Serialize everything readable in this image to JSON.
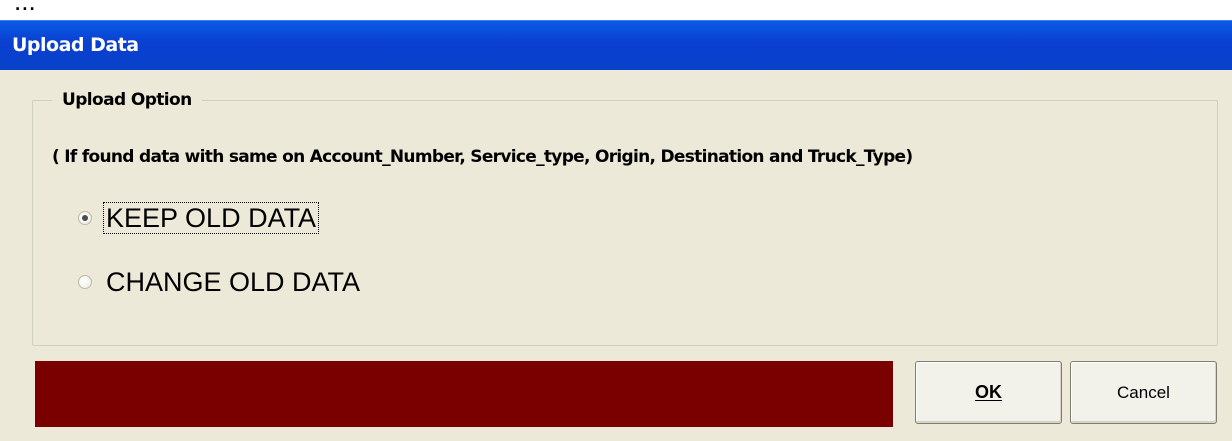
{
  "window": {
    "title": "Upload Data"
  },
  "top_strip_text": "...",
  "group": {
    "legend": "Upload Option",
    "note": "( If found data with same on  Account_Number, Service_type,  Origin, Destination and Truck_Type)"
  },
  "options": [
    {
      "label": "KEEP OLD DATA",
      "selected": true
    },
    {
      "label": "CHANGE OLD DATA",
      "selected": false
    }
  ],
  "buttons": {
    "ok_label": "OK",
    "cancel_label": "Cancel"
  },
  "colors": {
    "title_bar": "#0a46d6",
    "status_panel": "#7a0000",
    "dialog_bg": "#ece9d8"
  }
}
